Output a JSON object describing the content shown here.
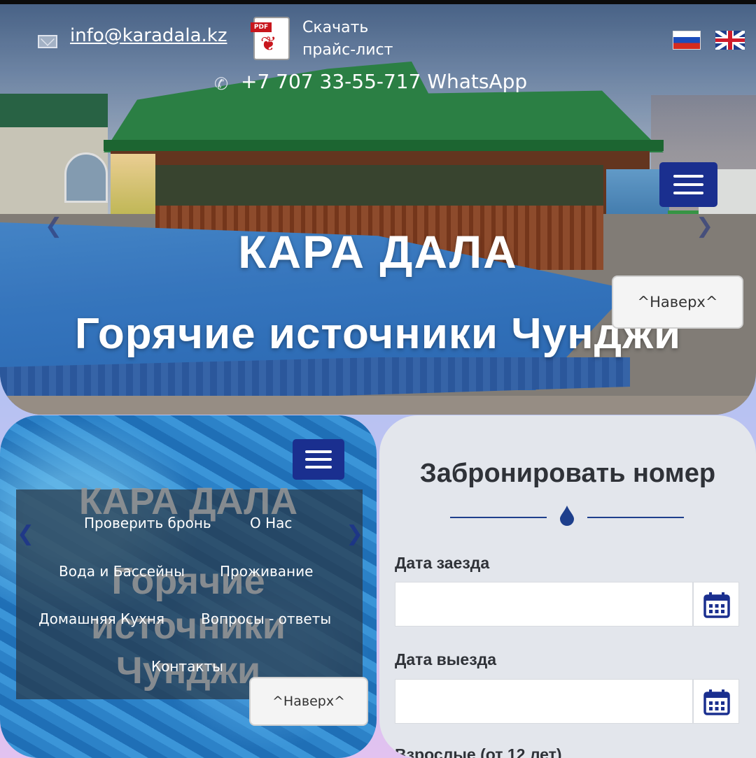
{
  "header": {
    "email": "info@karadala.kz",
    "price_list": {
      "line1": "Скачать",
      "line2": "прайс-лист"
    },
    "phone": "+7 707 33-55-717 WhatsApp",
    "pdf_tag": "PDF"
  },
  "hero": {
    "title": "КАРА ДАЛА",
    "subtitle": "Горячие источники Чунджи",
    "to_top": "^Наверх^"
  },
  "nav_panel": {
    "ghost_title": "КАРА ДАЛА",
    "ghost_sub1": "Горячие",
    "ghost_sub2": "источники",
    "ghost_sub3": "Чунджи",
    "items": [
      {
        "label": "Проверить бронь"
      },
      {
        "label": "О Нас"
      },
      {
        "label": "Вода и Бассейны"
      },
      {
        "label": "Проживание"
      },
      {
        "label": "Домашняя Кухня"
      },
      {
        "label": "Вопросы - ответы"
      },
      {
        "label": "Контакты"
      }
    ],
    "to_top": "^Наверх^"
  },
  "booking": {
    "title": "Забронировать номер",
    "checkin_label": "Дата заезда",
    "checkin_value": "",
    "checkout_label": "Дата выезда",
    "checkout_value": "",
    "adults_label": "Взрослые (от 12 лет)"
  },
  "colors": {
    "menu_button": "#1a2f8f",
    "accent_blue": "#1e3f8c",
    "panel_bg": "#e3e6ec"
  },
  "icons": [
    "mail-icon",
    "pdf-icon",
    "phone-icon",
    "flag-ru-icon",
    "flag-uk-icon",
    "hamburger-icon",
    "chevron-left-icon",
    "chevron-right-icon",
    "water-drop-icon",
    "calendar-icon"
  ]
}
